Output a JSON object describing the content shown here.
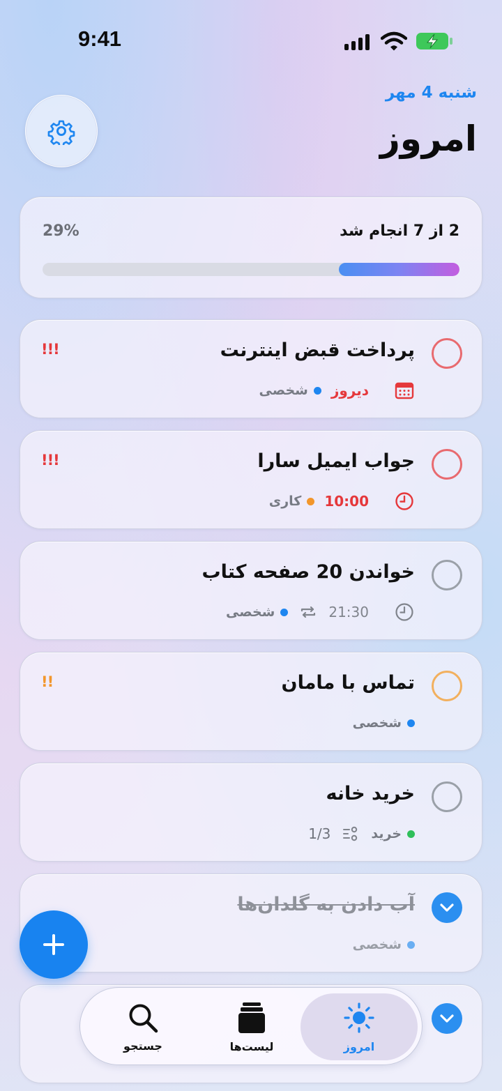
{
  "status_bar": {
    "time": "9:41"
  },
  "header": {
    "date": "شنبه 4 مهر",
    "title": "امروز",
    "settings_icon": "gear-icon"
  },
  "progress": {
    "summary": "2 از 7 انجام شد",
    "percent_label": "29%",
    "fraction": 0.29
  },
  "tasks": [
    {
      "title": "پرداخت قبض اینترنت",
      "date": "دیروز",
      "date_icon": "calendar-icon",
      "list": "شخصی",
      "list_color": "#1e86f0",
      "priority": "!!!",
      "priority_color": "#e5383b",
      "circle_color": "#e86a6f",
      "overdue": true
    },
    {
      "title": "جواب ایمیل سارا",
      "date": "10:00",
      "date_icon": "clock-icon",
      "list": "کاری",
      "list_color": "#f2962b",
      "priority": "!!!",
      "priority_color": "#e5383b",
      "circle_color": "#e86a6f",
      "overdue": true
    },
    {
      "title": "خواندن 20 صفحه کتاب",
      "date": "21:30",
      "date_icon": "clock-icon",
      "repeat_icon": "repeat-icon",
      "list": "شخصی",
      "list_color": "#1e86f0",
      "circle_color": "#9aa0a8"
    },
    {
      "title": "تماس با مامان",
      "list": "شخصی",
      "list_color": "#1e86f0",
      "priority": "!!",
      "priority_color": "#f2962b",
      "circle_color": "#f2b05e"
    },
    {
      "title": "خرید خانه",
      "list": "خرید",
      "list_color": "#2fbf5a",
      "subtasks": "1/3",
      "subtasks_icon": "subtasks-icon",
      "circle_color": "#9aa0a8"
    },
    {
      "title": "آب دادن به گلدان‌ها",
      "list": "شخصی",
      "list_color": "#1e86f0",
      "done": true
    }
  ],
  "tabbar": {
    "tabs": [
      {
        "label": "امروز",
        "icon": "sun-icon",
        "active": true
      },
      {
        "label": "لیست‌ها",
        "icon": "stack-icon"
      },
      {
        "label": "جستجو",
        "icon": "search-icon"
      }
    ]
  },
  "fab_icon": "plus-icon",
  "colors": {
    "accent": "#1883f0",
    "overdue": "#e5383b"
  }
}
